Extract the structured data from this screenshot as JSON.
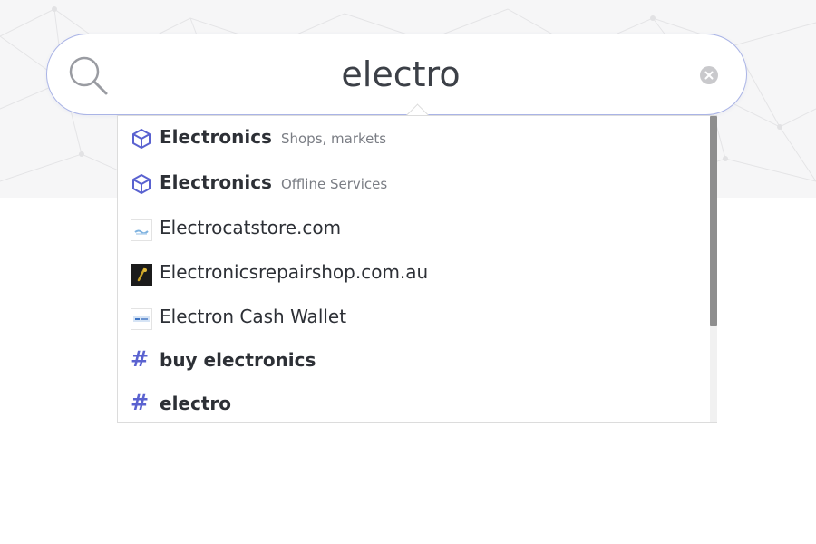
{
  "search": {
    "query": "electro",
    "placeholder": ""
  },
  "suggestions": [
    {
      "type": "category",
      "title": "Electronics",
      "subtitle": "Shops, markets",
      "icon": "cube-icon"
    },
    {
      "type": "category",
      "title": "Electronics",
      "subtitle": "Offline Services",
      "icon": "cube-icon"
    },
    {
      "type": "site",
      "title": "Electrocatstore.com",
      "icon": "favicon-electrocatstore"
    },
    {
      "type": "site",
      "title": "Electronicsrepairshop.com.au",
      "icon": "favicon-electronicsrepairshop"
    },
    {
      "type": "site",
      "title": "Electron Cash Wallet",
      "icon": "favicon-electron-cash"
    },
    {
      "type": "tag",
      "title": "buy electronics",
      "icon": "hash-icon"
    },
    {
      "type": "tag",
      "title": "electro",
      "icon": "hash-icon"
    }
  ],
  "colors": {
    "accent": "#5a62d0",
    "search_border": "#aab4e6",
    "text": "#2d3036",
    "subtext": "#7a7d84"
  }
}
